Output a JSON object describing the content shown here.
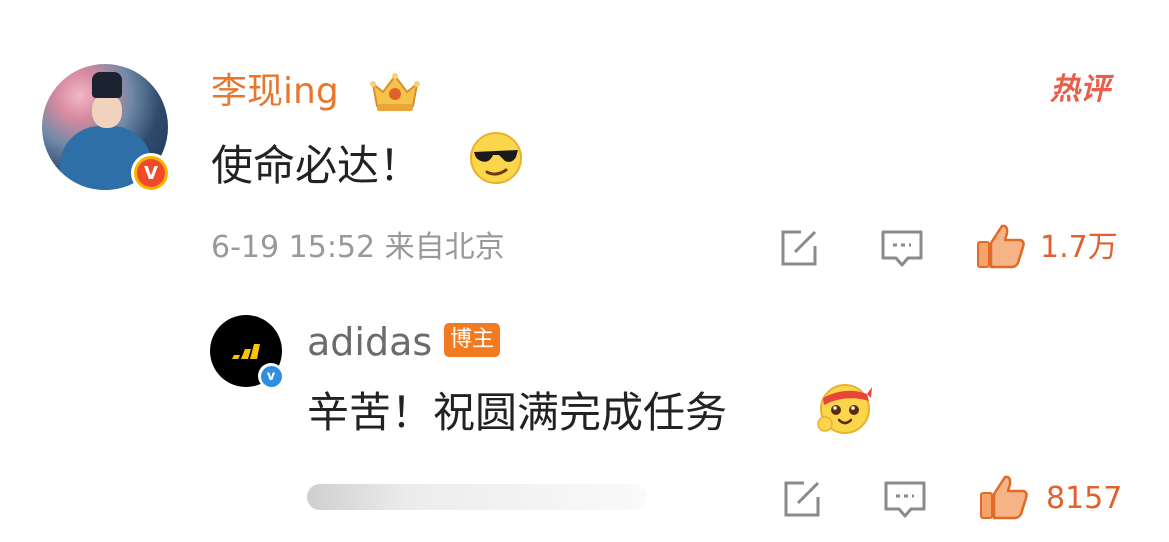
{
  "comment": {
    "username": "李现ing",
    "text": "使命必达！",
    "date": "6-19",
    "time": "15:52",
    "location": "来自北京",
    "like_count": "1.7万",
    "hot_label": "热评",
    "verified_badge": "V",
    "emoji": "cool-sunglasses-emoji",
    "crown_icon": "crown-icon"
  },
  "reply": {
    "username": "adidas",
    "badge": "博主",
    "text": "辛苦！祝圆满完成任务",
    "like_count": "8157",
    "verified_badge": "v",
    "emoji": "blessing-emoji"
  },
  "colors": {
    "username_orange": "#e8772e",
    "like_orange": "#e0612f",
    "hot_red": "#e8604c",
    "badge_orange": "#f27b21",
    "meta_gray": "#999999"
  }
}
